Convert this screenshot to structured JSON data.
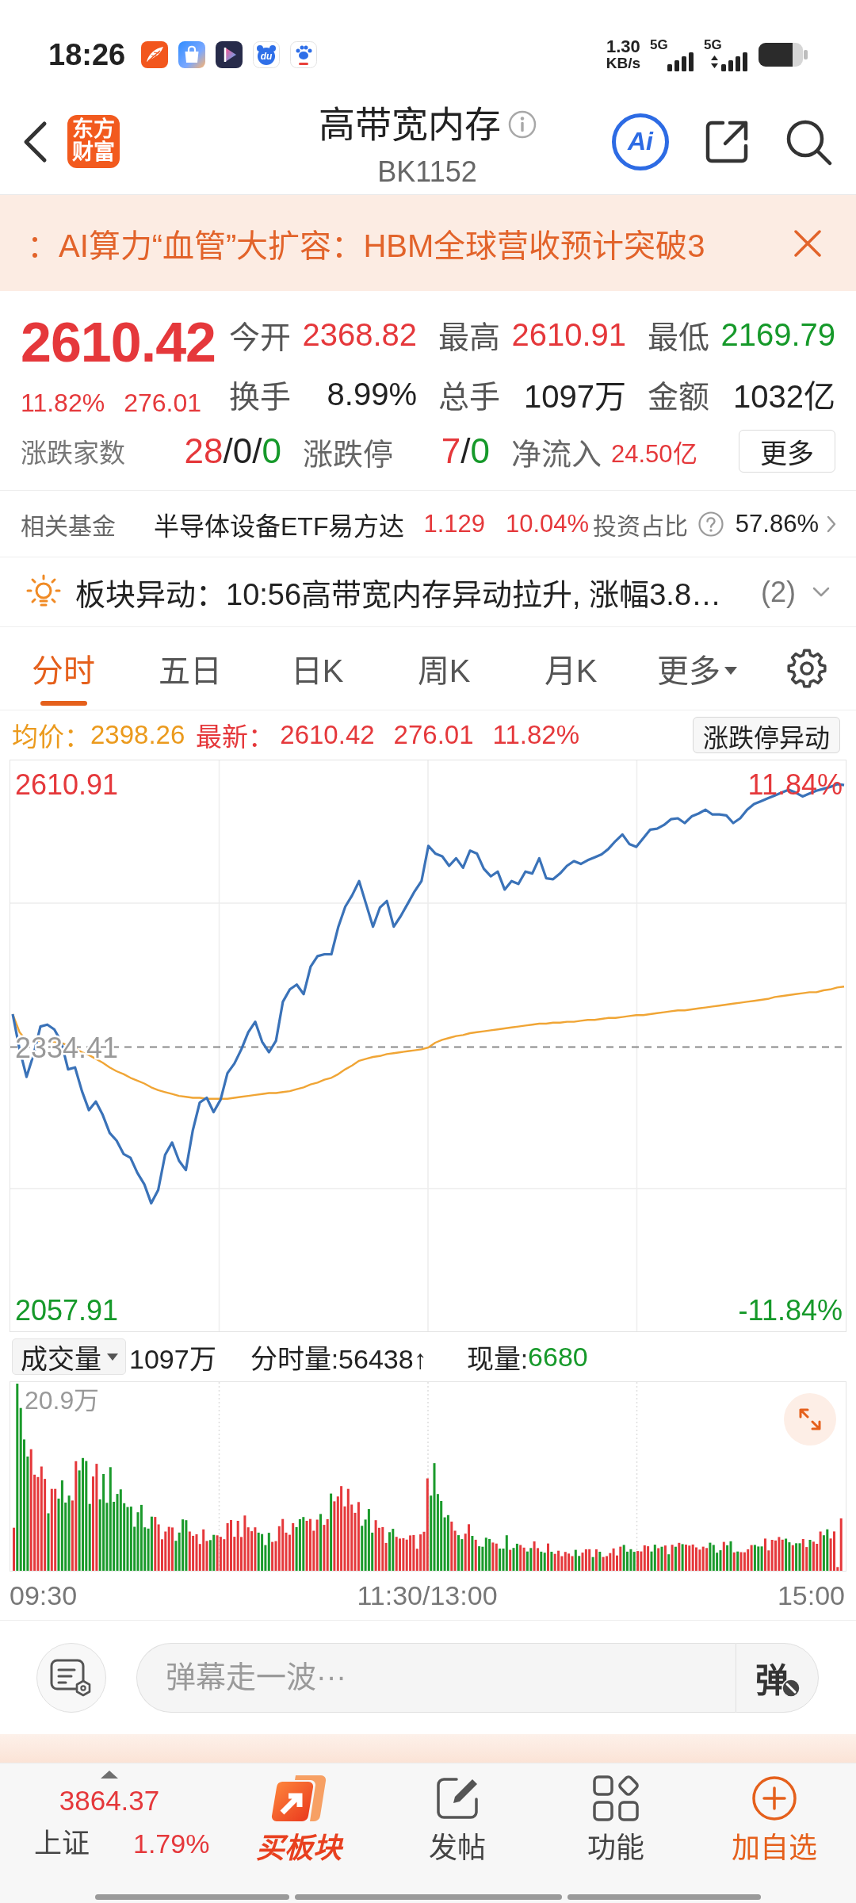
{
  "status_bar": {
    "time": "18:26",
    "notifications": [
      {
        "kind": "feather"
      },
      {
        "kind": "bag"
      },
      {
        "kind": "play"
      },
      {
        "kind": "du",
        "label": "du"
      },
      {
        "kind": "paw"
      }
    ],
    "net_speed": {
      "value": "1.30",
      "unit": "KB/s"
    },
    "signals": [
      {
        "label": "5G",
        "kind": "plain"
      },
      {
        "label": "5G",
        "kind": "data"
      }
    ]
  },
  "header": {
    "logo": "东方财富",
    "title": "高带宽内存",
    "code": "BK1152",
    "ai_label": "Ai"
  },
  "news_ticker": {
    "text": "：AI算力“血管”大扩容：HBM全球营收预计突破3"
  },
  "quote": {
    "price": "2610.42",
    "change_pct": "11.82%",
    "change": "276.01",
    "color": "#e5383b",
    "metrics": [
      {
        "label": "今开",
        "value": "2368.82",
        "color": "#e5383b"
      },
      {
        "label": "最高",
        "value": "2610.91",
        "color": "#e5383b"
      },
      {
        "label": "最低",
        "value": "2169.79",
        "color": "#16992a"
      },
      {
        "label": "换手",
        "value": "8.99%",
        "color": "#222222"
      },
      {
        "label": "总手",
        "value": "1097万",
        "color": "#222222"
      },
      {
        "label": "金额",
        "value": "1032亿",
        "color": "#222222"
      }
    ],
    "breadth": {
      "label": "涨跌家数",
      "parts": [
        {
          "text": "28",
          "color": "#e5383b"
        },
        {
          "text": "/",
          "color": "#222222"
        },
        {
          "text": "0",
          "color": "#222222"
        },
        {
          "text": "/",
          "color": "#222222"
        },
        {
          "text": "0",
          "color": "#16992a"
        }
      ]
    },
    "limit": {
      "label": "涨跌停",
      "parts": [
        {
          "text": "7",
          "color": "#e5383b"
        },
        {
          "text": "/",
          "color": "#222222"
        },
        {
          "text": "0",
          "color": "#16992a"
        }
      ]
    },
    "net_inflow": {
      "label": "净流入",
      "value": "24.50亿",
      "color": "#e5383b"
    },
    "more_button": "更多"
  },
  "related_fund": {
    "label": "相关基金",
    "name": "半导体设备ETF易方达",
    "price": "1.129",
    "change_pct": "10.04%",
    "color": "#e5383b",
    "ratio_label": "投资占比",
    "ratio": "57.86%"
  },
  "alert": {
    "text": "板块异动：10:56高带宽内存异动拉升, 涨幅3.8…",
    "count": "(2)",
    "expanded": false
  },
  "tabs": [
    {
      "label": "分时",
      "kind": "tab",
      "selected": true
    },
    {
      "label": "五日",
      "kind": "tab",
      "selected": false
    },
    {
      "label": "日K",
      "kind": "tab",
      "selected": false
    },
    {
      "label": "周K",
      "kind": "tab",
      "selected": false
    },
    {
      "label": "月K",
      "kind": "tab",
      "selected": false
    },
    {
      "label": "更多",
      "kind": "menu",
      "selected": false
    }
  ],
  "intraday": {
    "avg_label": "均价：",
    "avg": "2398.26",
    "latest_label": "最新：",
    "latest": "2610.42",
    "latest_change": "276.01",
    "latest_pct": "11.82%",
    "limit_button": "涨跌停异动",
    "right_labels": [
      {
        "label": "11.84%",
        "color": "#e5383b"
      },
      {
        "label": "-11.84%",
        "color": "#16992a"
      }
    ],
    "chart_data": {
      "type": "line",
      "ylim": [
        2035.4,
        2635.9
      ],
      "yticks": [
        {
          "value": 2610.91,
          "label": "2610.91"
        },
        {
          "value": 2334.41,
          "label": "2334.41"
        },
        {
          "value": 2057.91,
          "label": "2057.91"
        }
      ],
      "ref_lines": [
        {
          "axis": "y",
          "value": 2334.41
        }
      ],
      "categories": [
        null,
        null,
        null,
        null,
        null,
        null,
        null,
        null,
        null,
        null,
        null,
        null,
        null,
        null,
        null,
        null,
        null,
        null,
        null,
        null,
        null,
        null,
        null,
        null,
        null,
        null,
        null,
        null,
        null,
        null,
        null,
        null,
        null,
        null,
        null,
        null,
        null,
        null,
        null,
        null,
        null,
        null,
        null,
        null,
        null,
        null,
        null,
        null,
        null,
        null,
        null,
        null,
        null,
        null,
        null,
        null,
        null,
        null,
        null,
        null,
        null,
        null,
        null,
        null,
        null,
        null,
        null,
        null,
        null,
        null,
        null,
        null,
        null,
        null,
        null,
        null,
        null,
        null,
        null,
        null,
        null,
        null,
        null,
        null,
        null,
        null,
        null,
        null,
        null,
        null,
        null,
        null,
        null,
        null,
        null,
        null,
        null,
        null,
        null,
        null,
        null,
        null,
        null,
        null,
        null,
        null,
        null,
        null,
        null,
        null,
        null,
        null,
        null,
        null,
        null,
        null,
        null,
        null,
        null,
        null,
        null
      ],
      "series": [
        {
          "color": "#3a72b8",
          "values": [
            2369,
            2332,
            2303,
            2326,
            2356,
            2358,
            2353,
            2340,
            2311,
            2313,
            2288,
            2268,
            2277,
            2263,
            2244,
            2236,
            2222,
            2218,
            2202,
            2190,
            2170,
            2184,
            2221,
            2234,
            2215,
            2205,
            2247,
            2276,
            2281,
            2266,
            2279,
            2307,
            2317,
            2332,
            2350,
            2361,
            2340,
            2329,
            2341,
            2382,
            2395,
            2400,
            2390,
            2419,
            2430,
            2432,
            2432,
            2461,
            2482,
            2494,
            2509,
            2485,
            2461,
            2481,
            2488,
            2461,
            2472,
            2485,
            2498,
            2509,
            2546,
            2538,
            2535,
            2525,
            2533,
            2523,
            2541,
            2538,
            2522,
            2514,
            2519,
            2500,
            2509,
            2506,
            2519,
            2517,
            2533,
            2512,
            2511,
            2517,
            2525,
            2530,
            2527,
            2531,
            2534,
            2537,
            2543,
            2551,
            2558,
            2548,
            2545,
            2554,
            2563,
            2564,
            2568,
            2574,
            2575,
            2570,
            2577,
            2580,
            2584,
            2579,
            2579,
            2578,
            2570,
            2575,
            2584,
            2590,
            2593,
            2596,
            2599,
            2602,
            2605,
            2602,
            2598,
            2601,
            2604,
            2606,
            2608,
            2611,
            2610
          ]
        },
        {
          "color": "#f0a535",
          "values": [
            2369,
            2350,
            2341,
            2340,
            2341,
            2341,
            2340,
            2339,
            2336,
            2333,
            2329,
            2326,
            2322,
            2318,
            2313,
            2309,
            2306,
            2302,
            2299,
            2296,
            2292,
            2289,
            2287,
            2285,
            2283,
            2282,
            2281,
            2281,
            2280,
            2280,
            2280,
            2280,
            2281,
            2282,
            2283,
            2284,
            2285,
            2286,
            2286,
            2287,
            2288,
            2290,
            2292,
            2295,
            2297,
            2300,
            2302,
            2306,
            2311,
            2315,
            2320,
            2322,
            2324,
            2325,
            2327,
            2328,
            2329,
            2330,
            2331,
            2332,
            2334,
            2339,
            2342,
            2344,
            2346,
            2347,
            2349,
            2350,
            2351,
            2352,
            2353,
            2354,
            2355,
            2356,
            2357,
            2358,
            2359,
            2359,
            2360,
            2360,
            2361,
            2361,
            2362,
            2363,
            2363,
            2364,
            2365,
            2365,
            2366,
            2367,
            2368,
            2368,
            2369,
            2370,
            2371,
            2372,
            2373,
            2373,
            2374,
            2375,
            2376,
            2377,
            2378,
            2379,
            2380,
            2381,
            2382,
            2383,
            2384,
            2385,
            2387,
            2388,
            2389,
            2390,
            2391,
            2392,
            2392,
            2394,
            2395,
            2397,
            2398
          ]
        }
      ]
    }
  },
  "volume": {
    "selector": "成交量",
    "total": "1097万",
    "minute_volume": "分时量:56438↑",
    "current": {
      "label": "现量:",
      "value": "6680",
      "color": "#16992a"
    },
    "max_label": "20.9万",
    "time_labels": [
      "09:30",
      "11:30/13:00",
      "15:00"
    ]
  },
  "danmu": {
    "placeholder": "弹幕走一波···",
    "toggle": "弹",
    "enabled": false
  },
  "bottom_nav": {
    "index": {
      "name": "上证",
      "value": "3864.37",
      "change_pct": "1.79%",
      "color": "#e5383b"
    },
    "items": [
      {
        "label": "买板块",
        "kind": "brand"
      },
      {
        "label": "发帖",
        "kind": "post"
      },
      {
        "label": "功能",
        "kind": "tools"
      },
      {
        "label": "加自选",
        "kind": "add"
      }
    ]
  }
}
